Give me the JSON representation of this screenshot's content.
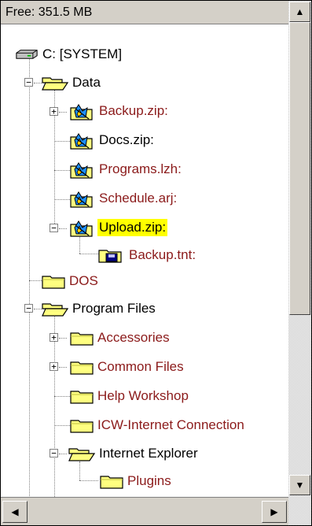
{
  "header": {
    "free_space": "Free: 351.5 MB"
  },
  "tree": {
    "drive": "C: [SYSTEM]",
    "data": "Data",
    "backup_zip": "Backup.zip:",
    "docs_zip": "Docs.zip:",
    "programs_lzh": "Programs.lzh:",
    "schedule_arj": "Schedule.arj:",
    "upload_zip": "Upload.zip:",
    "backup_tnt": "Backup.tnt:",
    "dos": "DOS",
    "program_files": "Program Files",
    "accessories": "Accessories",
    "common_files": "Common Files",
    "help_workshop": "Help Workshop",
    "icw": "ICW-Internet Connection",
    "internet_explorer": "Internet Explorer",
    "plugins": "Plugins"
  },
  "colors": {
    "archive_text": "#8b1a1a",
    "selection_highlight": "#ffff00",
    "folder_yellow": "#ffff80",
    "chrome": "#d4d0c8"
  },
  "icons": {
    "drive": "hard-drive-icon",
    "folder": "folder-icon",
    "open_folder": "open-folder-icon",
    "archive": "archive-icon",
    "backup_file": "backup-file-icon"
  },
  "scrollbars": {
    "up_arrow": "▲",
    "down_arrow": "▼",
    "left_arrow": "◀",
    "right_arrow": "▶"
  },
  "toggles": {
    "expanded": "−",
    "collapsed": "+"
  }
}
